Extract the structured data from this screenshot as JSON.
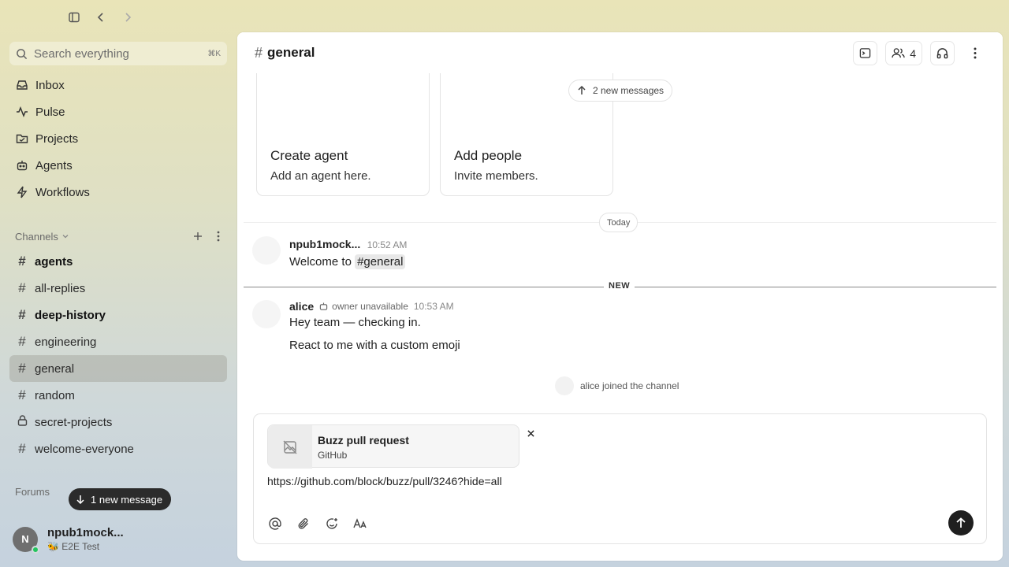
{
  "search": {
    "placeholder": "Search everything",
    "shortcut": "⌘K"
  },
  "nav": [
    {
      "label": "Inbox",
      "icon": "inbox-icon"
    },
    {
      "label": "Pulse",
      "icon": "pulse-icon"
    },
    {
      "label": "Projects",
      "icon": "folder-icon"
    },
    {
      "label": "Agents",
      "icon": "bot-icon"
    },
    {
      "label": "Workflows",
      "icon": "lightning-icon"
    }
  ],
  "channels_section": {
    "title": "Channels"
  },
  "channels": [
    {
      "name": "agents",
      "icon": "hash-icon",
      "unread": true
    },
    {
      "name": "all-replies",
      "icon": "hash-icon",
      "unread": false
    },
    {
      "name": "deep-history",
      "icon": "hash-icon",
      "unread": true
    },
    {
      "name": "engineering",
      "icon": "hash-icon",
      "unread": false
    },
    {
      "name": "general",
      "icon": "hash-icon",
      "active": true
    },
    {
      "name": "random",
      "icon": "hash-icon",
      "unread": false
    },
    {
      "name": "secret-projects",
      "icon": "lock-icon",
      "unread": false
    },
    {
      "name": "welcome-everyone",
      "icon": "hash-icon",
      "unread": false
    }
  ],
  "forums_section": {
    "title": "Forums"
  },
  "new_message_pill": "1 new message",
  "user": {
    "initial": "N",
    "name": "npub1mock...",
    "status": "🐝 E2E Test"
  },
  "channel": {
    "name": "general",
    "member_count": "4"
  },
  "cards": [
    {
      "title": "Create agent",
      "desc": "Add an agent here."
    },
    {
      "title": "Add people",
      "desc": "Invite members."
    }
  ],
  "new_messages_chip": "2 new messages",
  "day_label": "Today",
  "new_label": "NEW",
  "messages": [
    {
      "author": "npub1mock...",
      "time": "10:52 AM",
      "text_prefix": "Welcome to ",
      "mention": "#general"
    },
    {
      "author": "alice",
      "badge": "owner unavailable",
      "time": "10:53 AM",
      "lines": [
        "Hey team — checking in.",
        "React to me with a custom emoji"
      ]
    }
  ],
  "system_event": "alice joined the channel",
  "composer": {
    "preview_title": "Buzz pull request",
    "preview_source": "GitHub",
    "input_value": "https://github.com/block/buzz/pull/3246?hide=all"
  },
  "colors": {
    "accent": "#1f1f1f",
    "online": "#22c55e",
    "active_channel_bg": "#b9bcb3"
  }
}
